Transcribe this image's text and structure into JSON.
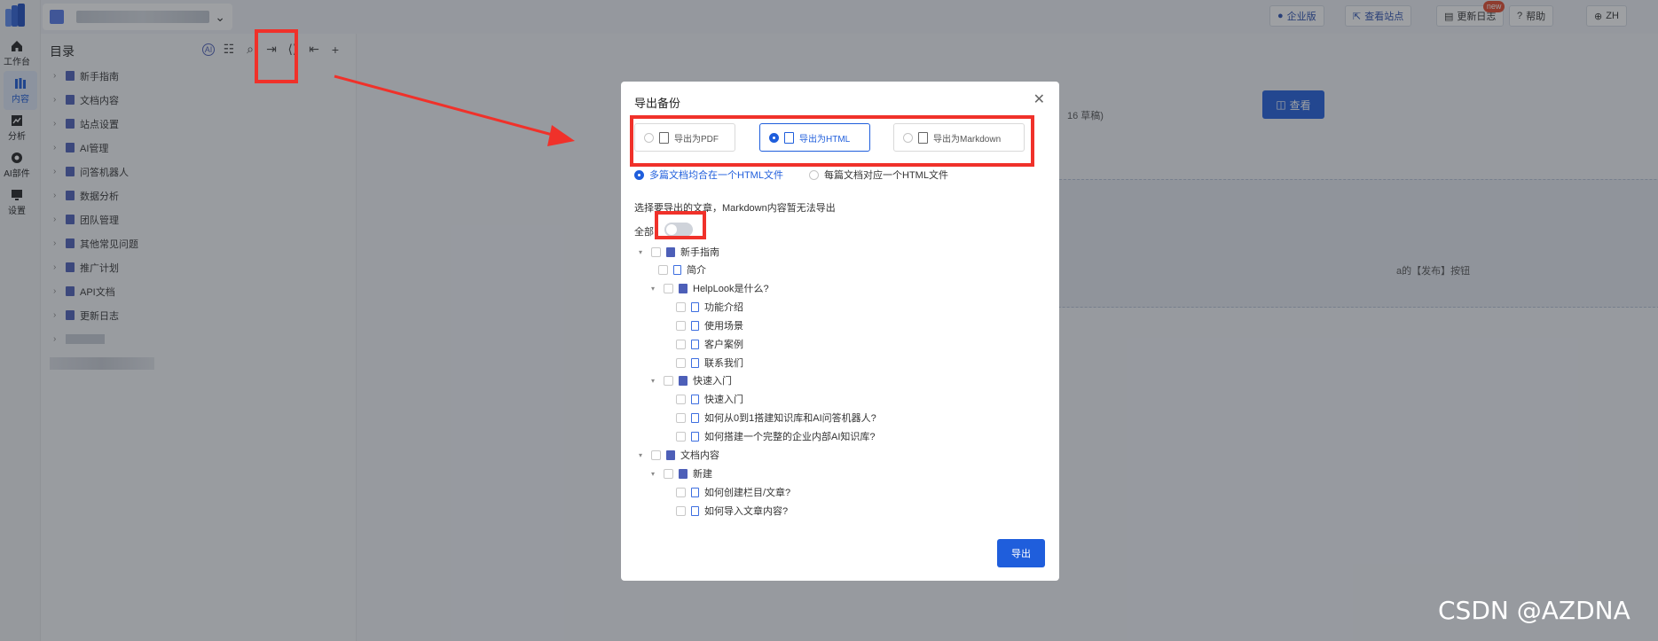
{
  "colors": {
    "accent": "#1f5edc",
    "annotation_red": "#f0312a",
    "overlay": "rgba(40,44,52,0.45)"
  },
  "topbar": {
    "buttons": [
      {
        "label": "企业版",
        "icon": "badge-icon"
      },
      {
        "label": "查看站点",
        "icon": "external-link-icon"
      },
      {
        "label": "更新日志",
        "icon": "doc-icon",
        "badge": "new"
      },
      {
        "label": "帮助",
        "icon": "help-icon"
      },
      {
        "label": "ZH",
        "icon": "globe-icon"
      }
    ]
  },
  "leftnav": [
    {
      "label": "工作台",
      "icon": "home-icon"
    },
    {
      "label": "内容",
      "icon": "content-icon",
      "active": true
    },
    {
      "label": "分析",
      "icon": "chart-icon"
    },
    {
      "label": "AI部件",
      "icon": "ai-icon"
    },
    {
      "label": "设置",
      "icon": "monitor-icon"
    }
  ],
  "sidebar": {
    "title": "目录",
    "tools": [
      "AI",
      "☷",
      "⌕",
      "⇥",
      "⟨⟩",
      "⇤",
      "+"
    ],
    "items": [
      "新手指南",
      "文档内容",
      "站点设置",
      "AI管理",
      "问答机器人",
      "数据分析",
      "团队管理",
      "其他常见问题",
      "推广计划",
      "API文档",
      "更新日志"
    ]
  },
  "main": {
    "view_label": "查看",
    "draft_text": "16 草稿)",
    "publish_text": "a的【发布】按钮"
  },
  "modal": {
    "title": "导出备份",
    "formats": [
      "导出为PDF",
      "导出为HTML",
      "导出为Markdown"
    ],
    "options": [
      "多篇文档均合在一个HTML文件",
      "每篇文档对应一个HTML文件"
    ],
    "hint": "选择要导出的文章，Markdown内容暂无法导出",
    "select_all": "全部",
    "tree": [
      "新手指南",
      "简介",
      "HelpLook是什么?",
      "功能介绍",
      "使用场景",
      "客户案例",
      "联系我们",
      "快速入门",
      "快速入门",
      "如何从0到1搭建知识库和AI问答机器人?",
      "如何搭建一个完整的企业内部AI知识库?",
      "文档内容",
      "新建",
      "如何创建栏目/文章?",
      "如何导入文章内容?"
    ],
    "export_label": "导出"
  },
  "watermark": "CSDN @AZDNA"
}
